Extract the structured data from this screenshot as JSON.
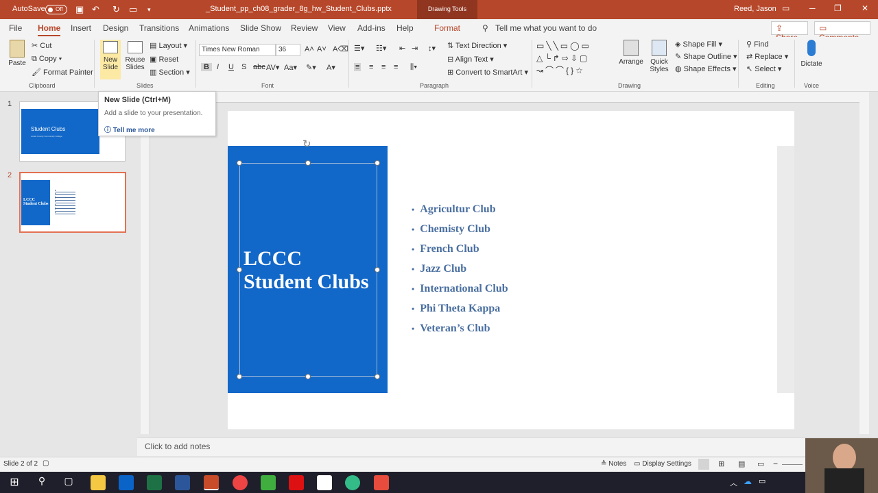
{
  "titlebar": {
    "autosave_label": "AutoSave",
    "autosave_state": "Off",
    "filename": "_Student_pp_ch08_grader_8g_hw_Student_Clubs.pptx",
    "context_tab": "Drawing Tools",
    "user": "Reed, Jason"
  },
  "tabs": [
    "File",
    "Home",
    "Insert",
    "Design",
    "Transitions",
    "Animations",
    "Slide Show",
    "Review",
    "View",
    "Add-ins",
    "Help",
    "Format"
  ],
  "tell_me": "Tell me what you want to do",
  "share_label": "Share",
  "comments_label": "Comments",
  "ribbon": {
    "paste": "Paste",
    "cut": "Cut",
    "copy": "Copy",
    "format_painter": "Format Painter",
    "clipboard": "Clipboard",
    "new_slide": "New Slide",
    "reuse_slides": "Reuse Slides",
    "layout": "Layout",
    "reset": "Reset",
    "section": "Section",
    "slides": "Slides",
    "font_name": "Times New Roman",
    "font_size": "36",
    "font": "Font",
    "text_direction": "Text Direction",
    "align_text": "Align Text",
    "convert_smartart": "Convert to SmartArt",
    "paragraph": "Paragraph",
    "arrange": "Arrange",
    "quick_styles": "Quick Styles",
    "shape_fill": "Shape Fill",
    "shape_outline": "Shape Outline",
    "shape_effects": "Shape Effects",
    "drawing": "Drawing",
    "find": "Find",
    "replace": "Replace",
    "select": "Select",
    "editing": "Editing",
    "dictate": "Dictate",
    "voice": "Voice"
  },
  "tooltip": {
    "title": "New Slide (Ctrl+M)",
    "desc": "Add a slide to your presentation.",
    "link": "Tell me more"
  },
  "thumbnails": [
    {
      "num": "1",
      "title": "Student Clubs",
      "subtitle": "Lorain County Community College"
    },
    {
      "num": "2",
      "title": "LCCC Student Clubs"
    }
  ],
  "slide": {
    "title_line1": "LCCC",
    "title_line2": "Student Clubs",
    "bullets": [
      "Agricultur Club",
      "Chemisty Club",
      "French Club",
      "Jazz Club",
      "International Club",
      "Phi Theta Kappa",
      "Veteran’s Club"
    ]
  },
  "notes_placeholder": "Click to add notes",
  "status": {
    "slide_info": "Slide 2 of 2",
    "notes": "Notes",
    "display_settings": "Display Settings"
  },
  "colors": {
    "accent": "#b7472a",
    "slide_blue": "#1268c8",
    "bullet_text": "#4a6fa0"
  }
}
